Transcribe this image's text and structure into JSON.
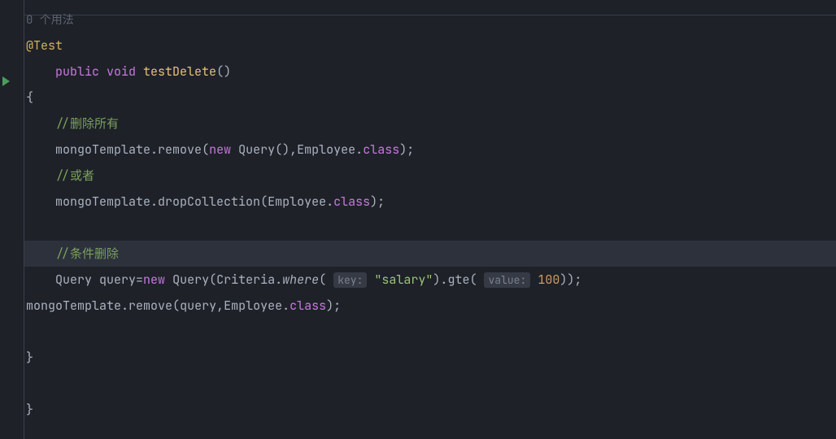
{
  "usages_hint": "0 个用法",
  "annotation": "@Test",
  "method_signature": {
    "modifiers": "public void",
    "name": "testDelete",
    "parens": "()"
  },
  "open_brace": "{",
  "close_brace": "}",
  "close_brace2": "}",
  "comments": {
    "delete_all": "//删除所有",
    "or": "//或者",
    "conditional_delete": "//条件删除"
  },
  "code": {
    "mongo_template": "mongoTemplate",
    "remove": "remove",
    "new_kw": "new",
    "query_class": "Query",
    "employee": "Employee",
    "class_kw": "class",
    "drop_collection": "dropCollection",
    "query_var": "Query query",
    "equals_new": "=new",
    "criteria": "Criteria",
    "where": "where",
    "key_hint": "key:",
    "salary_str": "\"salary\"",
    "gte": "gte",
    "value_hint": "value:",
    "hundred": "100",
    "query_arg": "query"
  }
}
